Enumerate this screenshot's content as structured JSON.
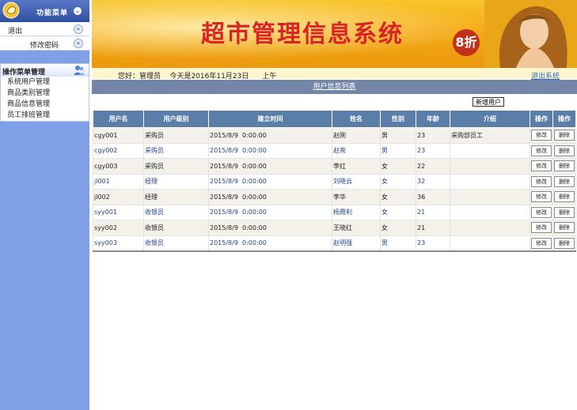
{
  "sidebar": {
    "menu_title": "功能菜单",
    "exit_label": "退出",
    "change_password_label": "修改密码",
    "ops_title": "操作菜单管理",
    "items": [
      {
        "label": "系统用户管理"
      },
      {
        "label": "商品类别管理"
      },
      {
        "label": "商品信息管理"
      },
      {
        "label": "员工排班管理"
      }
    ]
  },
  "banner": {
    "title": "超市管理信息系统",
    "badge": "8折"
  },
  "infobar": {
    "greeting": "您好：管理员    今天是2016年11月23日      上午",
    "logout": "退出系统"
  },
  "content": {
    "caption": "用户信息列表",
    "add_user": "新增用户"
  },
  "table": {
    "headers": [
      "用户名",
      "用户级别",
      "建立时间",
      "姓名",
      "性别",
      "年龄",
      "介绍",
      "操作",
      "操作"
    ],
    "edit_label": "修改",
    "delete_label": "删除",
    "rows": [
      {
        "username": "cgy001",
        "level": "采购员",
        "created": "2015/8/9  0:00:00",
        "name": "赵刚",
        "gender": "男",
        "age": "23",
        "intro": "采购部员工"
      },
      {
        "username": "cgy002",
        "level": "采购员",
        "created": "2015/8/9  0:00:00",
        "name": "赵亮",
        "gender": "男",
        "age": "23",
        "intro": ""
      },
      {
        "username": "cgy003",
        "level": "采购员",
        "created": "2015/8/9  0:00:00",
        "name": "李红",
        "gender": "女",
        "age": "22",
        "intro": ""
      },
      {
        "username": "jl001",
        "level": "经理",
        "created": "2015/8/9  0:00:00",
        "name": "刘晓云",
        "gender": "女",
        "age": "32",
        "intro": ""
      },
      {
        "username": "jl002",
        "level": "经理",
        "created": "2015/8/9  0:00:00",
        "name": "李华",
        "gender": "女",
        "age": "36",
        "intro": ""
      },
      {
        "username": "syy001",
        "level": "收银员",
        "created": "2015/8/9  0:00:00",
        "name": "杨霞利",
        "gender": "女",
        "age": "21",
        "intro": ""
      },
      {
        "username": "syy002",
        "level": "收银员",
        "created": "2015/8/9  0:00:00",
        "name": "王晓红",
        "gender": "女",
        "age": "21",
        "intro": ""
      },
      {
        "username": "syy003",
        "level": "收银员",
        "created": "2015/8/9  0:00:00",
        "name": "赵明强",
        "gender": "男",
        "age": "23",
        "intro": ""
      }
    ]
  },
  "colors": {
    "sidebar_bg": "#7f9fe6",
    "header_blue": "#5b7ea9",
    "banner_title": "#d82424",
    "banner_gold": "#f5a814"
  }
}
